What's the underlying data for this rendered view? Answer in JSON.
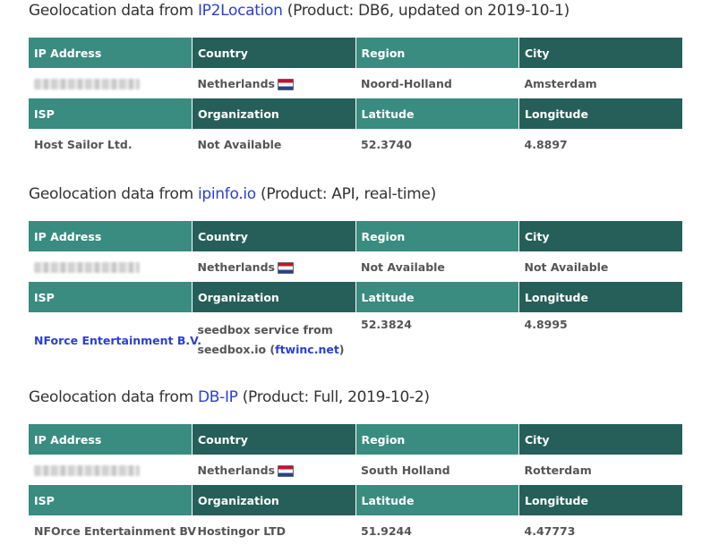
{
  "sections": [
    {
      "heading": {
        "prefix": "Geolocation data from ",
        "provider": "IP2Location",
        "suffix": " (Product: DB6, updated on 2019-10-1)"
      },
      "headers1": [
        "IP Address",
        "Country",
        "Region",
        "City"
      ],
      "row1": {
        "ip": "",
        "country": "Netherlands",
        "region": "Noord-Holland",
        "city": "Amsterdam"
      },
      "headers2": [
        "ISP",
        "Organization",
        "Latitude",
        "Longitude"
      ],
      "row2": {
        "isp": "Host Sailor Ltd.",
        "organization": "Not Available",
        "latitude": "52.3740",
        "longitude": "4.8897"
      }
    },
    {
      "heading": {
        "prefix": "Geolocation data from ",
        "provider": "ipinfo.io",
        "suffix": " (Product: API, real-time)"
      },
      "headers1": [
        "IP Address",
        "Country",
        "Region",
        "City"
      ],
      "row1": {
        "ip": "",
        "country": "Netherlands",
        "region": "Not Available",
        "city": "Not Available"
      },
      "headers2": [
        "ISP",
        "Organization",
        "Latitude",
        "Longitude"
      ],
      "row2": {
        "isp": "NForce Entertainment B.V.",
        "organization_text": "seedbox service from seedbox.io (",
        "organization_link": "ftwinc.net",
        "organization_end": ")",
        "latitude": "52.3824",
        "longitude": "4.8995"
      }
    },
    {
      "heading": {
        "prefix": "Geolocation data from ",
        "provider": "DB-IP",
        "suffix": " (Product: Full, 2019-10-2)"
      },
      "headers1": [
        "IP Address",
        "Country",
        "Region",
        "City"
      ],
      "row1": {
        "ip": "",
        "country": "Netherlands",
        "region": "South Holland",
        "city": "Rotterdam"
      },
      "headers2": [
        "ISP",
        "Organization",
        "Latitude",
        "Longitude"
      ],
      "row2": {
        "isp": "NFOrce Entertainment BV",
        "organization": "Hostingor LTD",
        "latitude": "51.9244",
        "longitude": "4.47773"
      }
    }
  ],
  "icons": {
    "flag": "netherlands-flag-icon",
    "redacted": "redacted-ip"
  },
  "colors": {
    "header_light": "#3a8b80",
    "header_dark": "#265f59",
    "link": "#2a3fd6"
  }
}
